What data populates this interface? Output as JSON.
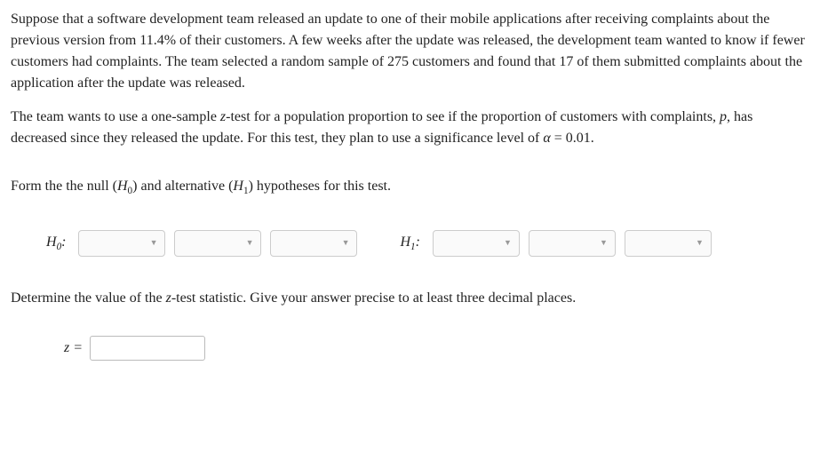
{
  "paragraph1": "Suppose that a software development team released an update to one of their mobile applications after receiving complaints about the previous version from 11.4% of their customers. A few weeks after the update was released, the development team wanted to know if fewer customers had complaints. The team selected a random sample of 275 customers and found that 17 of them submitted complaints about the application after the update was released.",
  "paragraph2_a": "The team wants to use a one-sample ",
  "paragraph2_z": "z",
  "paragraph2_b": "-test for a population proportion to see if the proportion of customers with complaints, ",
  "paragraph2_p": "p",
  "paragraph2_c": ", has decreased since they released the update. For this test, they plan to use a significance level of ",
  "paragraph2_alpha": "α",
  "paragraph2_d": " = 0.01.",
  "question1_a": "Form the the null (",
  "question1_H0_H": "H",
  "question1_H0_0": "0",
  "question1_b": ") and alternative (",
  "question1_H1_H": "H",
  "question1_H1_1": "1",
  "question1_c": ") hypotheses for this test.",
  "hyp": {
    "H0_label_H": "H",
    "H0_label_0": "0",
    "H0_colon": ":",
    "H1_label_H": "H",
    "H1_label_1": "1",
    "H1_colon": ":"
  },
  "question2_a": "Determine the value of the ",
  "question2_z": "z",
  "question2_b": "-test statistic. Give your answer precise to at least three decimal places.",
  "z_label_z": "z",
  "z_label_eq": " ="
}
